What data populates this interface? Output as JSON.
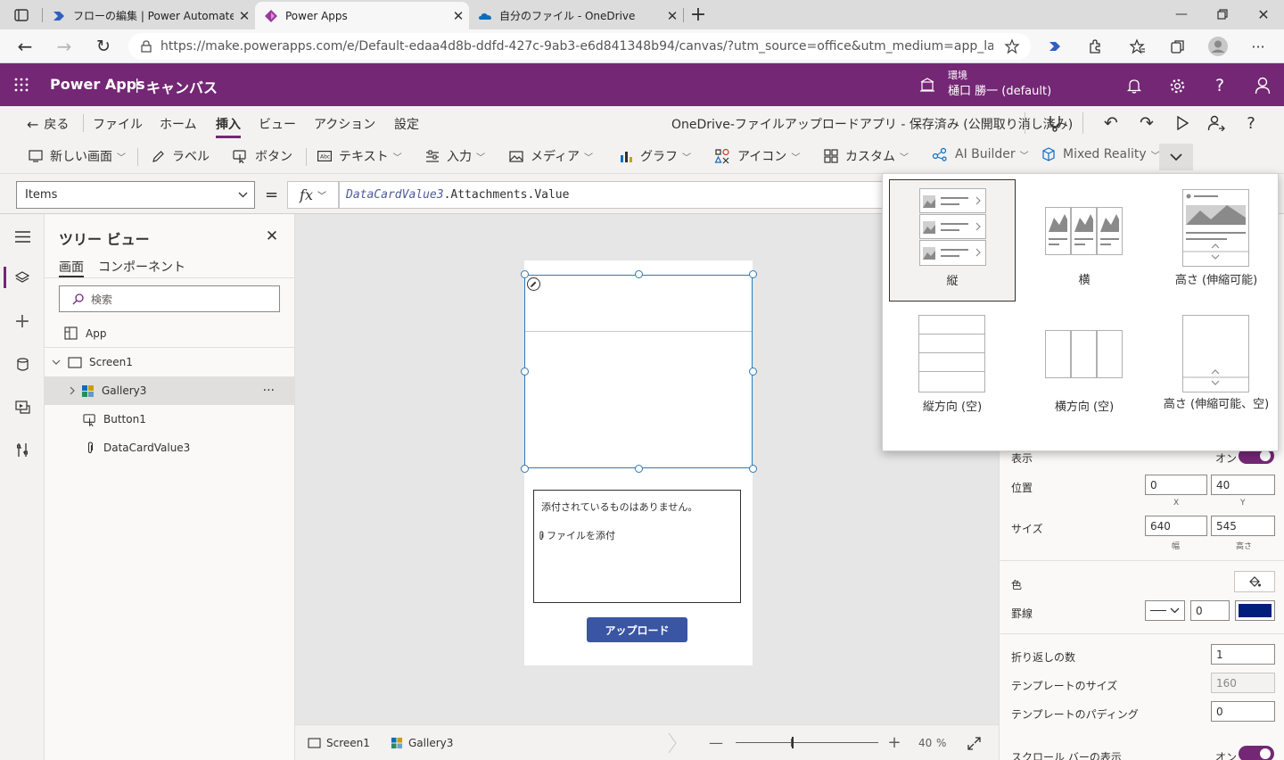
{
  "browser": {
    "tabs": [
      {
        "title": "フローの編集 | Power Automate",
        "active": false
      },
      {
        "title": "Power Apps",
        "active": true
      },
      {
        "title": "自分のファイル - OneDrive",
        "active": false
      }
    ],
    "url": "https://make.powerapps.com/e/Default-edaa4d8b-ddfd-427c-9ab3-e6d841348b94/canvas/?utm_source=office&utm_medium=app_launcher&utm_..."
  },
  "app_header": {
    "app_name": "Power Apps",
    "separator": "|",
    "mode": "キャンバス",
    "env_label": "環境",
    "env_name": "樋口 勝一 (default)"
  },
  "menubar": {
    "back": "戻る",
    "items": [
      "ファイル",
      "ホーム",
      "挿入",
      "ビュー",
      "アクション",
      "設定"
    ],
    "active": "挿入",
    "doc_status": "OneDrive-ファイルアップロードアプリ - 保存済み (公開取り消し済み)"
  },
  "insertbar": {
    "items": [
      "新しい画面",
      "ラベル",
      "ボタン",
      "テキスト",
      "入力",
      "メディア",
      "グラフ",
      "アイコン",
      "カスタム",
      "AI Builder",
      "Mixed Reality"
    ]
  },
  "formula": {
    "property": "Items",
    "equals": "=",
    "fx": "fx",
    "expr_ident": "DataCardValue3",
    "expr_rest": ".Attachments.Value"
  },
  "tree": {
    "title": "ツリー ビュー",
    "tabs": [
      "画面",
      "コンポーネント"
    ],
    "search_placeholder": "検索",
    "nodes": [
      "App",
      "Screen1",
      "Gallery3",
      "Button1",
      "DataCardValue3"
    ],
    "more": "···"
  },
  "canvas": {
    "attachment_empty": "添付されているものはありません。",
    "attach_link": "ファイルを添付",
    "upload_button": "アップロード"
  },
  "statusbar": {
    "crumbs": [
      "Screen1",
      "Gallery3"
    ],
    "zoom_value": "40",
    "zoom_unit": "%",
    "zoom_level": 0.4
  },
  "props": {
    "visible_label": "表示",
    "visible_value": "オン",
    "position_label": "位置",
    "x": "0",
    "y": "40",
    "x_sub": "X",
    "y_sub": "Y",
    "size_label": "サイズ",
    "width": "640",
    "height": "545",
    "w_sub": "幅",
    "h_sub": "高さ",
    "color_label": "色",
    "border_label": "罫線",
    "border_width": "0",
    "border_color": "#001f7a",
    "wrap_label": "折り返しの数",
    "wrap_value": "1",
    "template_size_label": "テンプレートのサイズ",
    "template_size_value": "160",
    "template_padding_label": "テンプレートのパディング",
    "template_padding_value": "0",
    "scrollbar_label": "スクロール バーの表示",
    "scrollbar_value": "オン"
  },
  "gallery_flyout": {
    "options": [
      "縦",
      "横",
      "高さ (伸縮可能)",
      "縦方向 (空)",
      "横方向 (空)",
      "高さ (伸縮可能、空)"
    ],
    "selected": "縦"
  },
  "colors": {
    "brand": "#742774",
    "selection": "#2f79b8",
    "button": "#3955a3"
  }
}
